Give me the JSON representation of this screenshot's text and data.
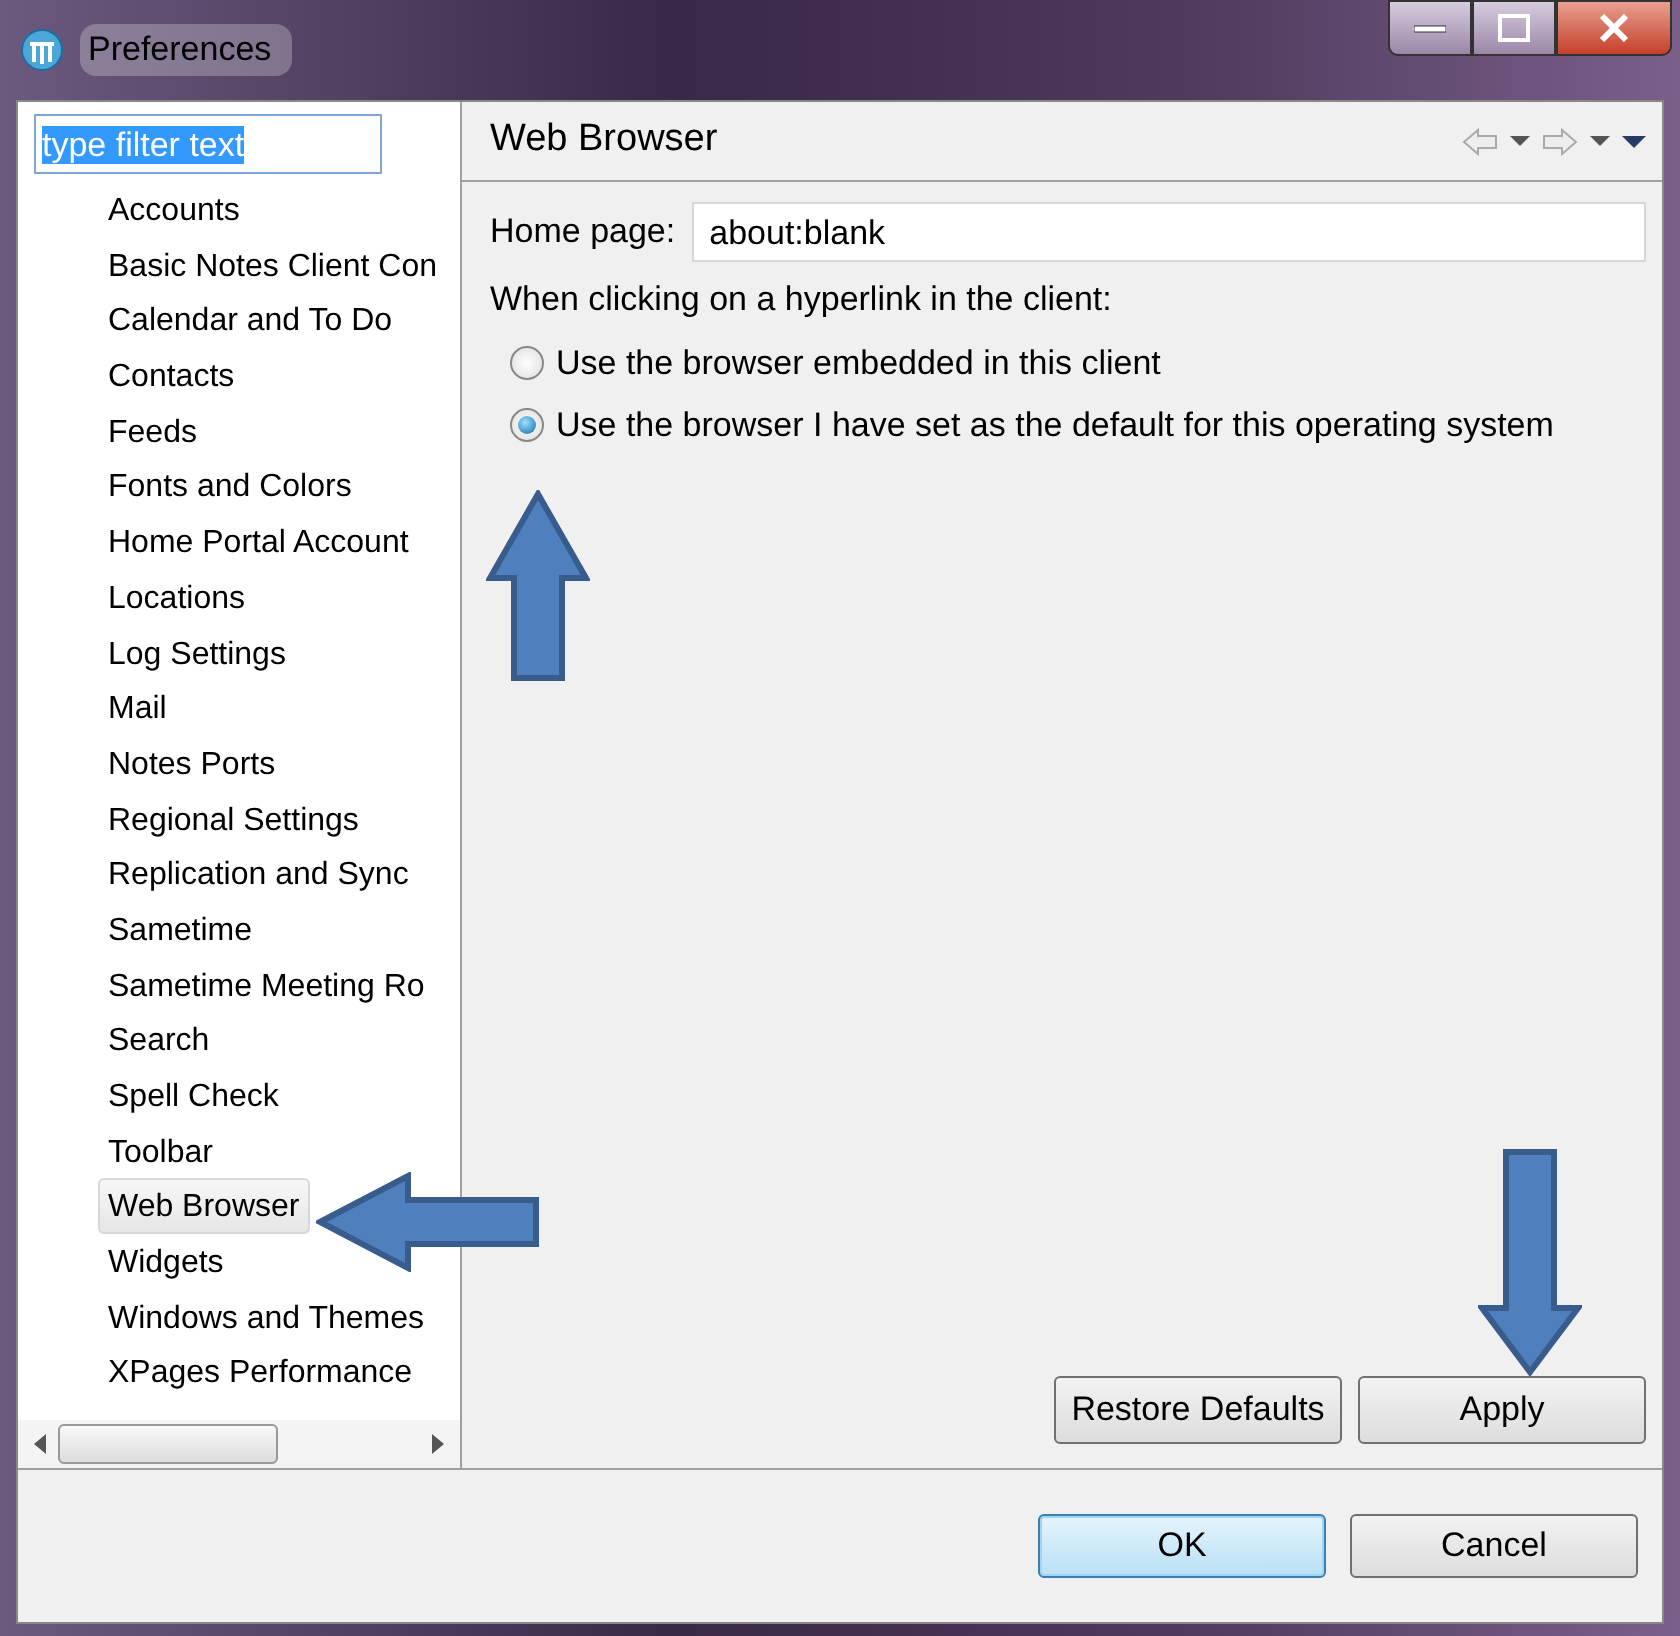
{
  "window": {
    "title": "Preferences"
  },
  "filter": {
    "value": "type filter text",
    "highlighted": true
  },
  "sidebar": {
    "items": [
      {
        "label": "Accounts",
        "selected": false
      },
      {
        "label": "Basic Notes Client Con",
        "selected": false
      },
      {
        "label": "Calendar and To Do",
        "selected": false
      },
      {
        "label": "Contacts",
        "selected": false
      },
      {
        "label": "Feeds",
        "selected": false
      },
      {
        "label": "Fonts and Colors",
        "selected": false
      },
      {
        "label": "Home Portal Account",
        "selected": false
      },
      {
        "label": "Locations",
        "selected": false
      },
      {
        "label": "Log Settings",
        "selected": false
      },
      {
        "label": "Mail",
        "selected": false
      },
      {
        "label": "Notes Ports",
        "selected": false
      },
      {
        "label": "Regional Settings",
        "selected": false
      },
      {
        "label": "Replication and Sync",
        "selected": false
      },
      {
        "label": "Sametime",
        "selected": false
      },
      {
        "label": "Sametime Meeting Ro",
        "selected": false
      },
      {
        "label": "Search",
        "selected": false
      },
      {
        "label": "Spell Check",
        "selected": false
      },
      {
        "label": "Toolbar",
        "selected": false
      },
      {
        "label": "Web Browser",
        "selected": true
      },
      {
        "label": "Widgets",
        "selected": false
      },
      {
        "label": "Windows and Themes",
        "selected": false
      },
      {
        "label": "XPages Performance",
        "selected": false
      }
    ]
  },
  "page": {
    "title": "Web Browser",
    "home_page": {
      "label": "Home page:",
      "value": "about:blank"
    },
    "prompt": "When clicking on a hyperlink in the client:",
    "options": [
      {
        "label": "Use the browser embedded in this client",
        "selected": false
      },
      {
        "label": "Use the browser I have set as the default for this operating system",
        "selected": true
      }
    ],
    "buttons": [
      {
        "label": "Restore Defaults",
        "default": false
      },
      {
        "label": "Apply",
        "default": false
      }
    ]
  },
  "dialog_buttons": [
    {
      "label": "OK",
      "default": true
    },
    {
      "label": "Cancel",
      "default": false
    }
  ],
  "annotation_arrows": [
    {
      "kind": "up"
    },
    {
      "kind": "left"
    },
    {
      "kind": "down"
    }
  ]
}
